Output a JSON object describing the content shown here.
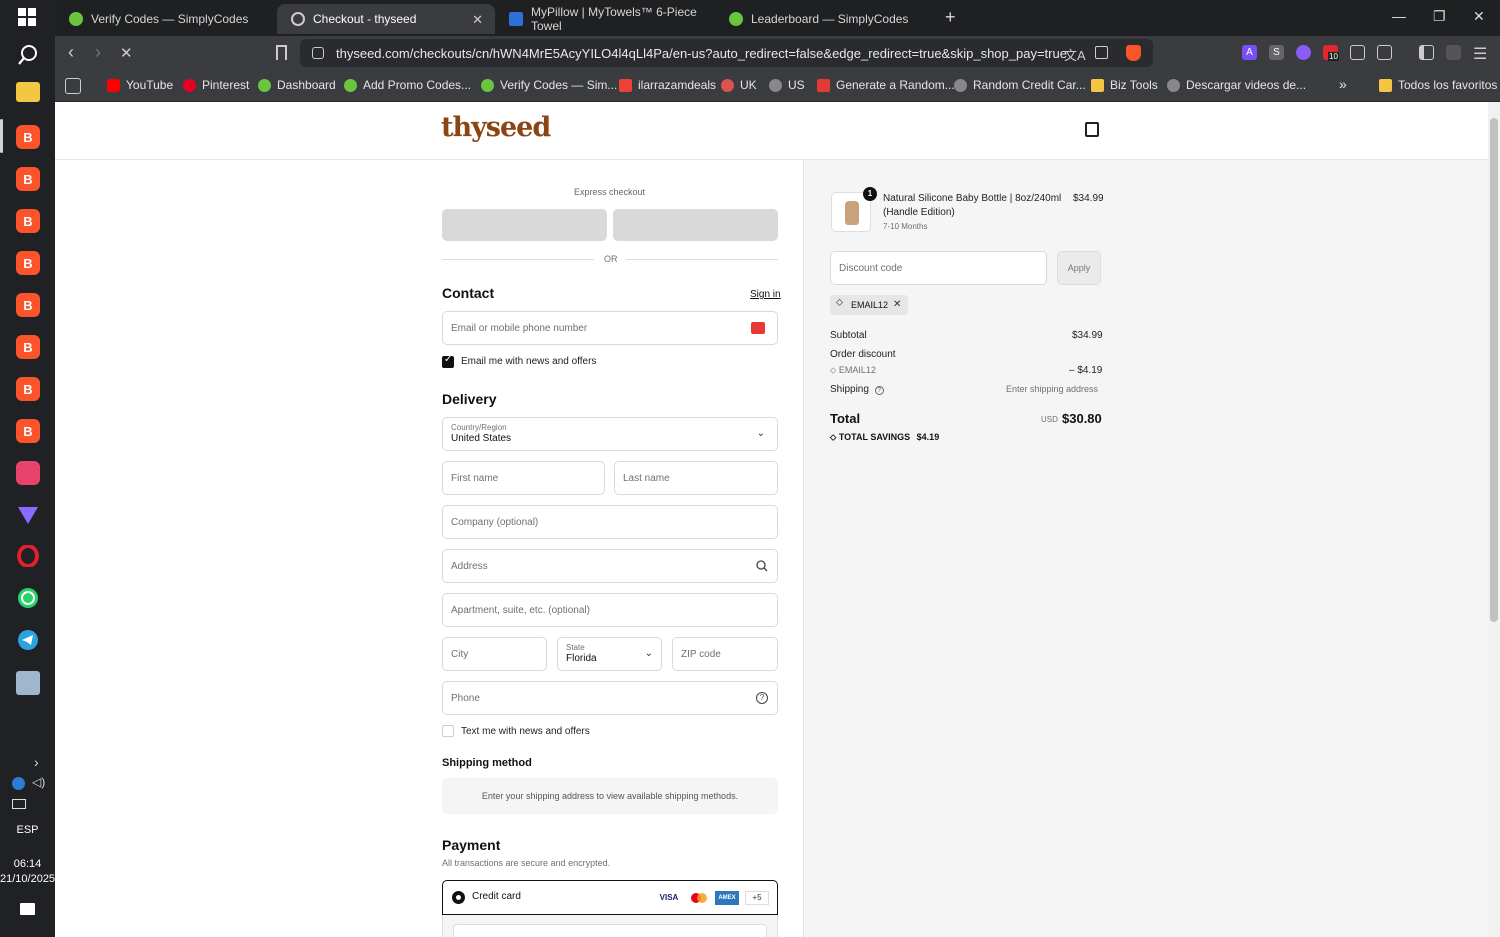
{
  "taskbar": {
    "lang": "ESP",
    "time": "06:14",
    "date": "21/10/2025",
    "icons": [
      "search-icon",
      "file-explorer-icon",
      "brave-icon",
      "brave-icon",
      "brave-icon",
      "brave-icon",
      "brave-icon",
      "brave-icon",
      "brave-icon",
      "brave-icon",
      "app-icon",
      "proton-vpn-icon",
      "opera-icon",
      "whatsapp-icon",
      "telegram-icon",
      "remote-desktop-icon"
    ]
  },
  "tabs": [
    {
      "title": "Verify Codes — SimplyCodes",
      "color": "#6ac53f"
    },
    {
      "title": "Checkout - thyseed",
      "color": "#cccccc",
      "active": true
    },
    {
      "title": "MyPillow | MyTowels™ 6-Piece Towel",
      "color": "#2e6fd8"
    },
    {
      "title": "Leaderboard — SimplyCodes",
      "color": "#6ac53f"
    }
  ],
  "toolbar": {
    "url": "thyseed.com/checkouts/cn/hWN4MrE5AcyYILO4l4qLl4Pa/en-us?auto_redirect=false&edge_redirect=true&skip_shop_pay=true",
    "extension_badge": "10"
  },
  "bookmarks": [
    {
      "label": "YouTube",
      "color": "#ff0000"
    },
    {
      "label": "Pinterest",
      "color": "#e60023"
    },
    {
      "label": "Dashboard",
      "color": "#6ac53f"
    },
    {
      "label": "Add Promo Codes...",
      "color": "#6ac53f"
    },
    {
      "label": "Verify Codes — Sim...",
      "color": "#6ac53f"
    },
    {
      "label": "ilarrazamdeals",
      "color": "#ea4335"
    },
    {
      "label": "UK",
      "color": "#d9534f"
    },
    {
      "label": "US",
      "color": "#888888"
    },
    {
      "label": "Generate a Random...",
      "color": "#e53935"
    },
    {
      "label": "Random Credit Car...",
      "color": "#888888"
    },
    {
      "label": "Biz Tools",
      "color": "#f4c542"
    },
    {
      "label": "Descargar videos de...",
      "color": "#888888"
    }
  ],
  "bookmarks_all": "Todos los favoritos",
  "bookmarks_more": "»",
  "checkout": {
    "logo": "thyseed",
    "express_checkout": "Express checkout",
    "or": "OR",
    "contact": {
      "title": "Contact",
      "sign_in": "Sign in",
      "email_placeholder": "Email or mobile phone number",
      "newsletter": "Email me with news and offers"
    },
    "delivery": {
      "title": "Delivery",
      "country_label": "Country/Region",
      "country_value": "United States",
      "first_name": "First name",
      "last_name": "Last name",
      "company": "Company (optional)",
      "address": "Address",
      "apartment": "Apartment, suite, etc. (optional)",
      "city": "City",
      "state_label": "State",
      "state_value": "Florida",
      "zip": "ZIP code",
      "phone": "Phone",
      "sms": "Text me with news and offers"
    },
    "shipping": {
      "title": "Shipping method",
      "message": "Enter your shipping address to view available shipping methods."
    },
    "payment": {
      "title": "Payment",
      "subtitle": "All transactions are secure and encrypted.",
      "credit_card": "Credit card",
      "brands": [
        "VISA",
        "MC",
        "AMEX"
      ],
      "more": "+5"
    }
  },
  "summary": {
    "item": {
      "name_line1": "Natural Silicone Baby Bottle | 8oz/240ml",
      "name_line2": "(Handle Edition)",
      "variant": "7-10 Months",
      "qty": "1",
      "price": "$34.99"
    },
    "discount_placeholder": "Discount code",
    "apply": "Apply",
    "applied_code": "EMAIL12",
    "subtotal_label": "Subtotal",
    "subtotal": "$34.99",
    "order_discount_label": "Order discount",
    "discount_code": "EMAIL12",
    "discount_value": "– $4.19",
    "shipping_label": "Shipping",
    "shipping_value": "Enter shipping address",
    "total_label": "Total",
    "currency": "USD",
    "total": "$30.80",
    "savings_label": "TOTAL SAVINGS",
    "savings": "$4.19"
  }
}
